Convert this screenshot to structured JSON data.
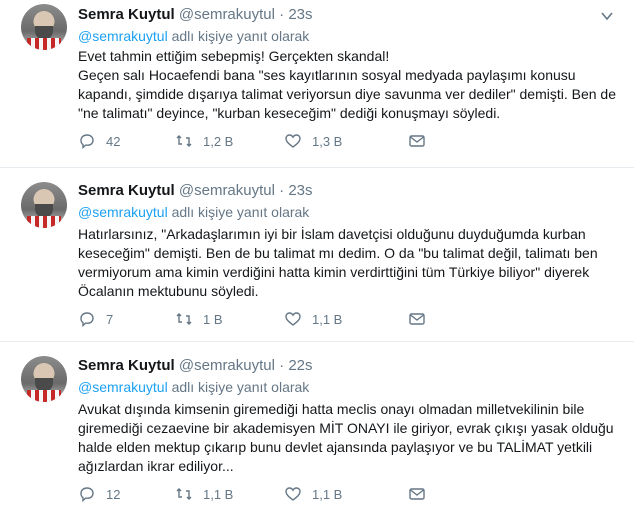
{
  "tweets": [
    {
      "name": "Semra Kuytul",
      "handle": "@semrakuytul",
      "dot": "·",
      "time": "23s",
      "reply_mention": "@semrakuytul",
      "reply_suffix": " adlı kişiye yanıt olarak",
      "text": "Evet tahmin ettiğim sebepmiş! Gerçekten skandal!\nGeçen salı Hocaefendi bana \"ses kayıtlarının sosyal medyada paylaşımı konusu kapandı, şimdide dışarıya talimat veriyorsun diye savunma ver dediler\" demişti. Ben de \"ne talimatı\" deyince, \"kurban keseceğim\" dediği konuşmayı söyledi.",
      "replies": "42",
      "retweets": "1,2 B",
      "likes": "1,3 B"
    },
    {
      "name": "Semra Kuytul",
      "handle": "@semrakuytul",
      "dot": "·",
      "time": "23s",
      "reply_mention": "@semrakuytul",
      "reply_suffix": " adlı kişiye yanıt olarak",
      "text": "Hatırlarsınız, \"Arkadaşlarımın iyi bir İslam davetçisi olduğunu duyduğumda kurban keseceğim\" demişti. Ben de bu talimat mı dedim. O da \"bu talimat değil, talimatı ben vermiyorum ama kimin verdiğini hatta kimin verdirttiğini tüm Türkiye biliyor\" diyerek Öcalanın mektubunu söyledi.",
      "replies": "7",
      "retweets": "1 B",
      "likes": "1,1 B"
    },
    {
      "name": "Semra Kuytul",
      "handle": "@semrakuytul",
      "dot": "·",
      "time": "22s",
      "reply_mention": "@semrakuytul",
      "reply_suffix": " adlı kişiye yanıt olarak",
      "text": "Avukat dışında kimsenin giremediği hatta meclis onayı olmadan milletvekilinin bile giremediği cezaevine bir akademisyen MİT ONAYI ile giriyor, evrak çıkışı yasak olduğu halde elden mektup çıkarıp bunu devlet ajansında paylaşıyor ve bu TALİMAT yetkili ağızlardan ikrar ediliyor...",
      "replies": "12",
      "retweets": "1,1 B",
      "likes": "1,1 B"
    }
  ]
}
